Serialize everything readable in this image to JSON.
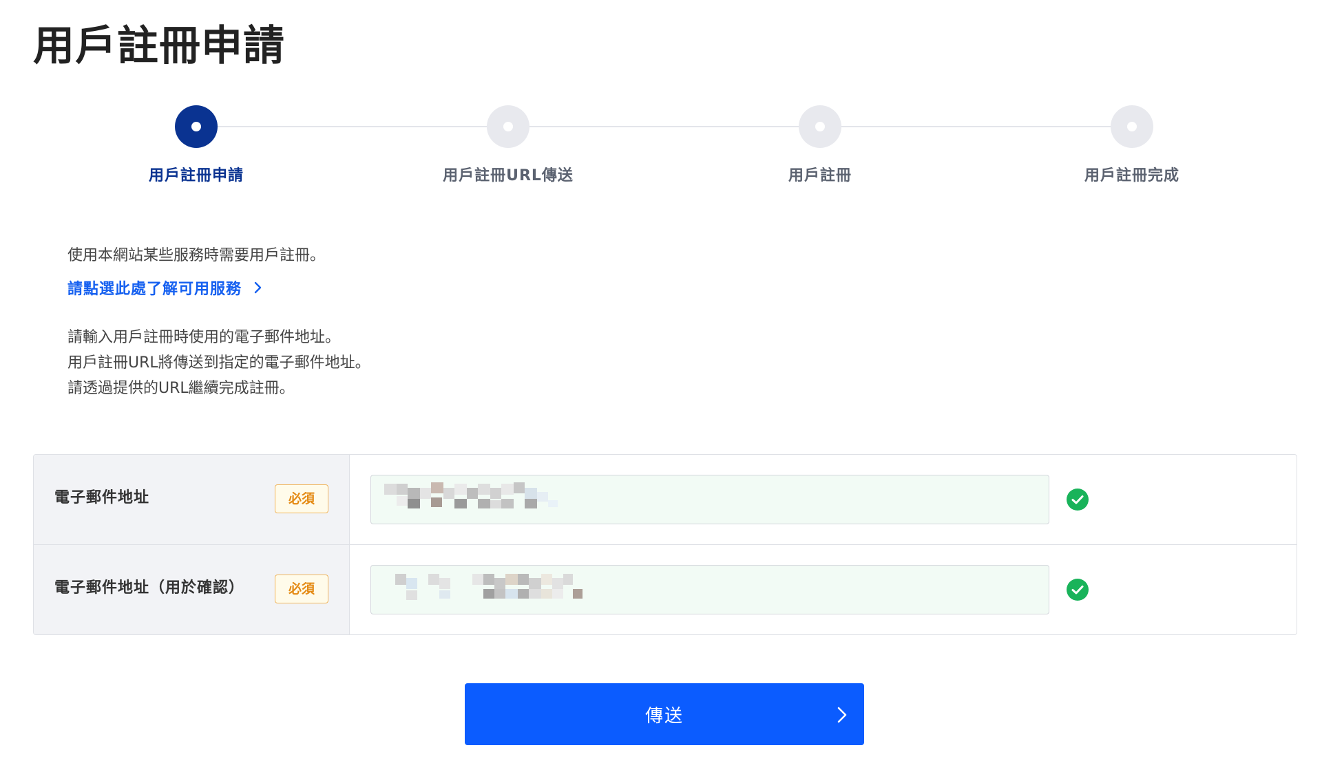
{
  "page": {
    "title": "用戶註冊申請"
  },
  "stepper": {
    "current_step": 1,
    "steps": [
      {
        "label": "用戶註冊申請",
        "active": true
      },
      {
        "label": "用戶註冊URL傳送",
        "active": false
      },
      {
        "label": "用戶註冊",
        "active": false
      },
      {
        "label": "用戶註冊完成",
        "active": false
      }
    ]
  },
  "intro": {
    "text": "使用本網站某些服務時需要用戶註冊。",
    "services_link_label": "請點選此處了解可用服務"
  },
  "instructions": {
    "lines": [
      "請輸入用戶註冊時使用的電子郵件地址。",
      "用戶註冊URL將傳送到指定的電子郵件地址。",
      "請透過提供的URL繼續完成註冊。"
    ]
  },
  "form": {
    "fields": [
      {
        "label": "電子郵件地址",
        "required_badge": "必須",
        "value_state": "redacted (pixelated)",
        "valid": true
      },
      {
        "label": "電子郵件地址（用於確認）",
        "required_badge": "必須",
        "value_state": "redacted (pixelated)",
        "valid": true
      }
    ]
  },
  "submit": {
    "label": "傳送"
  },
  "icons": {
    "step_dot": "step-dot-icon",
    "link_chevron": "chevron-right-icon",
    "valid": "check-circle-icon",
    "submit_chevron": "chevron-right-icon"
  },
  "colors": {
    "primary": "#0b5cff",
    "step_active": "#0a3391",
    "step_inactive": "#e8e9ee",
    "link": "#1560f0",
    "valid": "#19b35a",
    "required_border": "#f0b45a",
    "required_text": "#e48a14",
    "label_cell_bg": "#f2f3f6",
    "input_valid_bg": "#f2fbf5"
  }
}
